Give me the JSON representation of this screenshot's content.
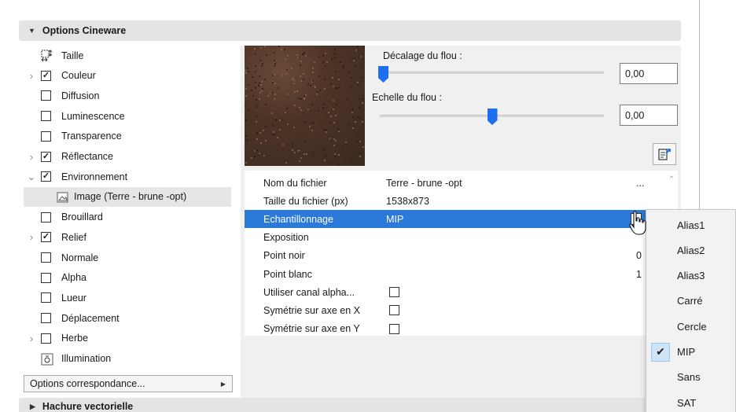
{
  "header": {
    "title": "Options Cineware"
  },
  "tree": {
    "items": [
      {
        "label": "Taille",
        "expand": "",
        "checked": null,
        "icon": "resize-icon"
      },
      {
        "label": "Couleur",
        "expand": "›",
        "checked": true
      },
      {
        "label": "Diffusion",
        "expand": "",
        "checked": false
      },
      {
        "label": "Luminescence",
        "expand": "",
        "checked": false
      },
      {
        "label": "Transparence",
        "expand": "",
        "checked": false
      },
      {
        "label": "Réflectance",
        "expand": "›",
        "checked": true
      },
      {
        "label": "Environnement",
        "expand": "⌄",
        "checked": true
      },
      {
        "label": "Image (Terre - brune -opt)",
        "sub": true,
        "icon": "image-icon"
      },
      {
        "label": "Brouillard",
        "expand": "",
        "checked": false
      },
      {
        "label": "Relief",
        "expand": "›",
        "checked": true
      },
      {
        "label": "Normale",
        "expand": "",
        "checked": false
      },
      {
        "label": "Alpha",
        "expand": "",
        "checked": false
      },
      {
        "label": "Lueur",
        "expand": "",
        "checked": false
      },
      {
        "label": "Déplacement",
        "expand": "",
        "checked": false
      },
      {
        "label": "Herbe",
        "expand": "›",
        "checked": false
      },
      {
        "label": "Illumination",
        "expand": "",
        "checked": null,
        "icon": "illumination-icon"
      }
    ],
    "options_button": "Options correspondance..."
  },
  "blur": {
    "offset_label": "Décalage du flou :",
    "offset_value": "0,00",
    "offset_level": 0.0,
    "scale_label": "Echelle du flou :",
    "scale_value": "0,00",
    "scale_level": 0.5
  },
  "properties": [
    {
      "key": "Nom du fichier",
      "value": "Terre - brune -opt",
      "right": "..."
    },
    {
      "key": "Taille du fichier (px)",
      "value": "1538x873",
      "right": ""
    },
    {
      "key": "Echantillonnage",
      "value": "MIP",
      "right": "",
      "highlight": true,
      "dropdown": true
    },
    {
      "key": "Exposition",
      "value": "",
      "right": ""
    },
    {
      "key": "Point noir",
      "value": "",
      "right": "0"
    },
    {
      "key": "Point blanc",
      "value": "",
      "right": "1"
    },
    {
      "key": "Utiliser canal alpha...",
      "value": "",
      "right": "",
      "checkbox": true
    },
    {
      "key": "Symétrie sur axe en X",
      "value": "",
      "right": "",
      "checkbox": true
    },
    {
      "key": "Symétrie sur axe en Y",
      "value": "",
      "right": "",
      "checkbox": true
    }
  ],
  "menu": {
    "items": [
      {
        "label": "Alias1",
        "checked": false
      },
      {
        "label": "Alias2",
        "checked": false
      },
      {
        "label": "Alias3",
        "checked": false
      },
      {
        "label": "Carré",
        "checked": false
      },
      {
        "label": "Cercle",
        "checked": false
      },
      {
        "label": "MIP",
        "checked": true
      },
      {
        "label": "Sans",
        "checked": false
      },
      {
        "label": "SAT",
        "checked": false
      }
    ]
  },
  "footer": {
    "title": "Hachure vectorielle"
  },
  "colors": {
    "accent": "#2b79d8",
    "slider": "#1e6ff0",
    "header_bg": "#e4e4e4"
  }
}
